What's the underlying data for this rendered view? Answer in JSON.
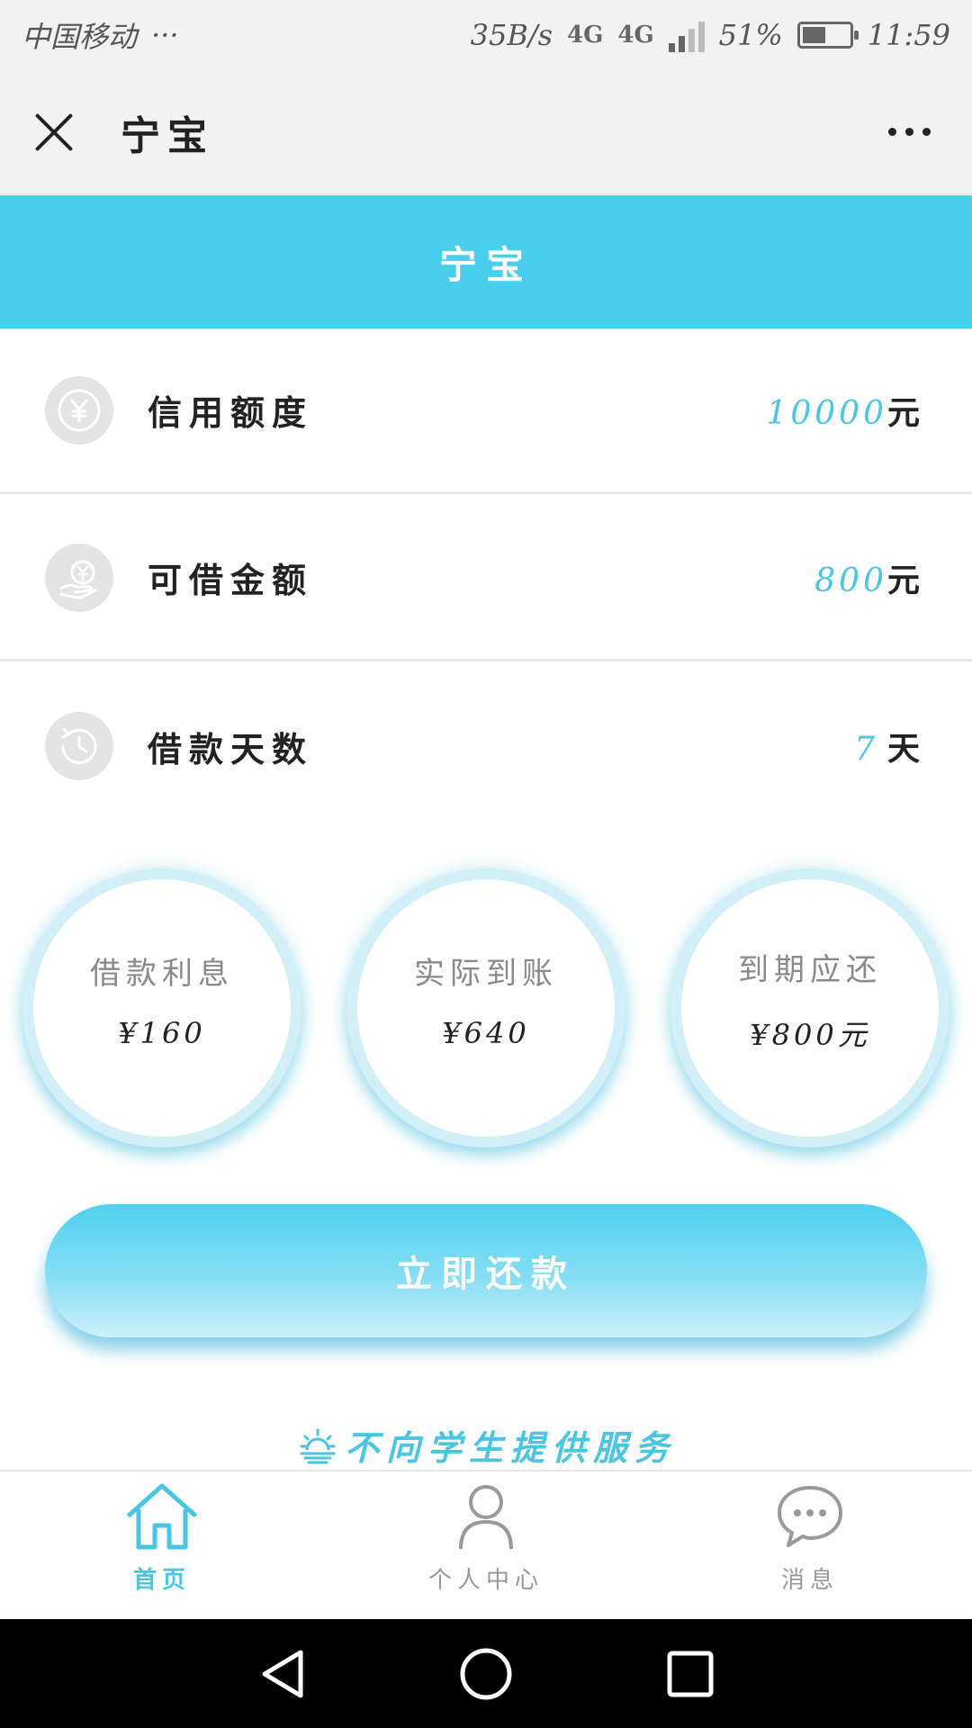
{
  "statusbar": {
    "carrier": "中国移动",
    "dots": "···",
    "speed": "35B/s",
    "network_a": "4G",
    "network_b": "4G",
    "battery_level": 0.51,
    "battery_text": "51%",
    "time": "11:59"
  },
  "navbar": {
    "title": "宁宝",
    "close_icon": "close-icon",
    "more_icon": "more-icon"
  },
  "banner": {
    "title": "宁宝"
  },
  "info_rows": [
    {
      "icon": "yen-coin-icon",
      "label": "信用额度",
      "value": "10000",
      "unit": "元"
    },
    {
      "icon": "hand-money-icon",
      "label": "可借金额",
      "value": "800",
      "unit": "元"
    },
    {
      "icon": "clock-icon",
      "label": "借款天数",
      "value": "7",
      "unit": "天"
    }
  ],
  "summary": [
    {
      "label": "借款利息",
      "value": "¥160"
    },
    {
      "label": "实际到账",
      "value": "¥640"
    },
    {
      "label": "到期应还",
      "value": "¥800元"
    }
  ],
  "repay_button": {
    "label": "立即还款"
  },
  "notice": {
    "text": "不向学生提供服务",
    "icon": "sunrise-icon"
  },
  "tabs": [
    {
      "label": "首页",
      "icon": "home-icon",
      "active": true
    },
    {
      "label": "个人中心",
      "icon": "user-icon",
      "active": false
    },
    {
      "label": "消息",
      "icon": "chat-icon",
      "active": false
    }
  ],
  "colors": {
    "accent": "#48cfee",
    "accent_text": "#48c6e3",
    "navbar_bg": "#f2f2f2",
    "icon_bg": "#e4e4e4"
  }
}
